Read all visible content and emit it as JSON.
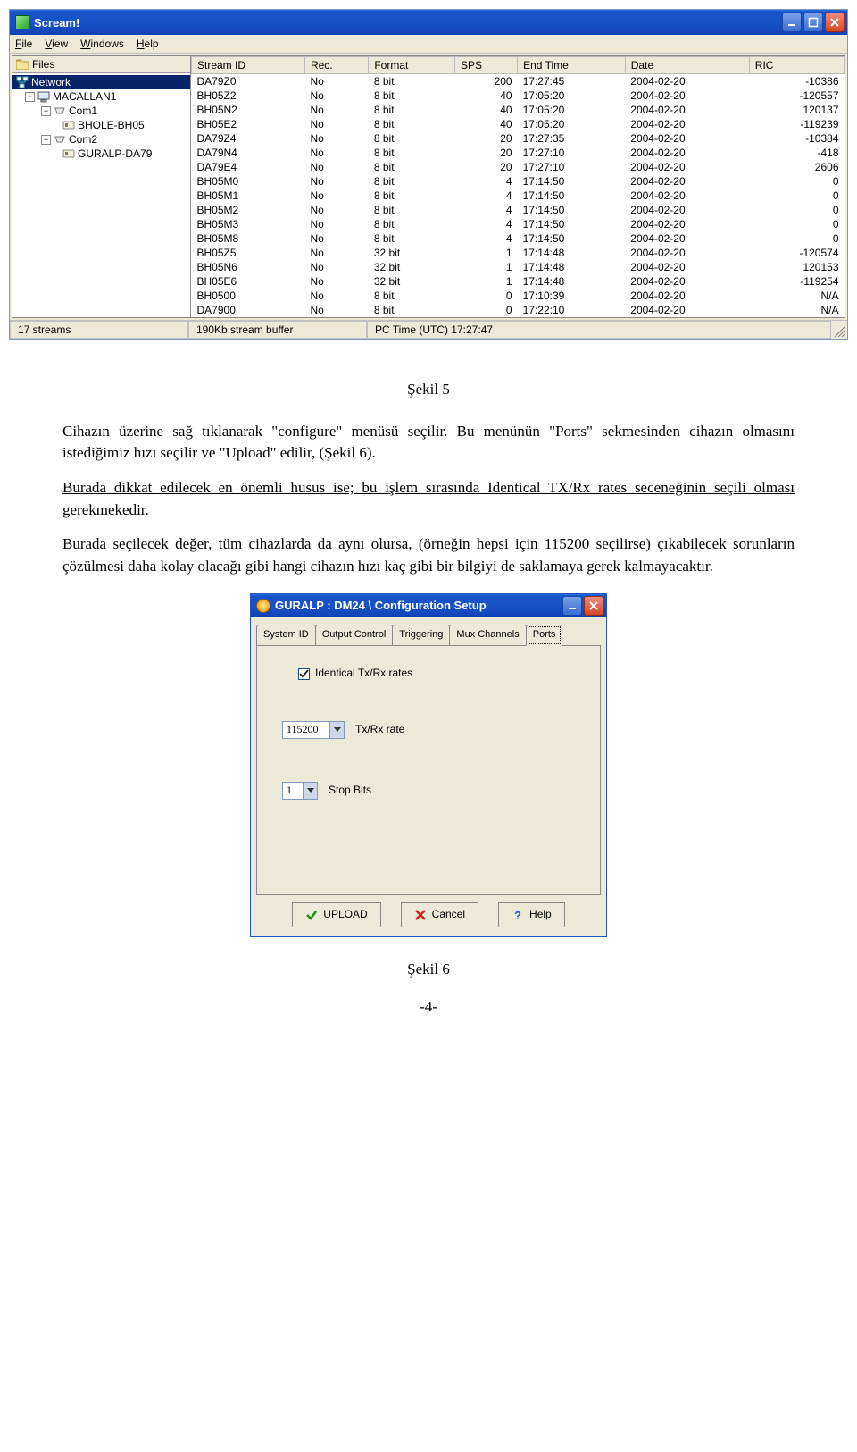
{
  "app_window": {
    "title": "Scream!",
    "menu": {
      "file": "File",
      "view": "View",
      "windows": "Windows",
      "help": "Help"
    },
    "tree": {
      "header": "Files",
      "root": "Network",
      "host": "MACALLAN1",
      "com1": "Com1",
      "com1_device": "BHOLE-BH05",
      "com2": "Com2",
      "com2_device": "GURALP-DA79"
    },
    "columns": {
      "c0": "Stream ID",
      "c1": "Rec.",
      "c2": "Format",
      "c3": "SPS",
      "c4": "End Time",
      "c5": "Date",
      "c6": "RIC"
    },
    "rows": [
      {
        "id": "DA79Z0",
        "rec": "No",
        "fmt": "8 bit",
        "sps": "200",
        "end": "17:27:45",
        "date": "2004-02-20",
        "ric": "-10386"
      },
      {
        "id": "BH05Z2",
        "rec": "No",
        "fmt": "8 bit",
        "sps": "40",
        "end": "17:05:20",
        "date": "2004-02-20",
        "ric": "-120557"
      },
      {
        "id": "BH05N2",
        "rec": "No",
        "fmt": "8 bit",
        "sps": "40",
        "end": "17:05:20",
        "date": "2004-02-20",
        "ric": "120137"
      },
      {
        "id": "BH05E2",
        "rec": "No",
        "fmt": "8 bit",
        "sps": "40",
        "end": "17:05:20",
        "date": "2004-02-20",
        "ric": "-119239"
      },
      {
        "id": "DA79Z4",
        "rec": "No",
        "fmt": "8 bit",
        "sps": "20",
        "end": "17:27:35",
        "date": "2004-02-20",
        "ric": "-10384"
      },
      {
        "id": "DA79N4",
        "rec": "No",
        "fmt": "8 bit",
        "sps": "20",
        "end": "17:27:10",
        "date": "2004-02-20",
        "ric": "-418"
      },
      {
        "id": "DA79E4",
        "rec": "No",
        "fmt": "8 bit",
        "sps": "20",
        "end": "17:27:10",
        "date": "2004-02-20",
        "ric": "2606"
      },
      {
        "id": "BH05M0",
        "rec": "No",
        "fmt": "8 bit",
        "sps": "4",
        "end": "17:14:50",
        "date": "2004-02-20",
        "ric": "0"
      },
      {
        "id": "BH05M1",
        "rec": "No",
        "fmt": "8 bit",
        "sps": "4",
        "end": "17:14:50",
        "date": "2004-02-20",
        "ric": "0"
      },
      {
        "id": "BH05M2",
        "rec": "No",
        "fmt": "8 bit",
        "sps": "4",
        "end": "17:14:50",
        "date": "2004-02-20",
        "ric": "0"
      },
      {
        "id": "BH05M3",
        "rec": "No",
        "fmt": "8 bit",
        "sps": "4",
        "end": "17:14:50",
        "date": "2004-02-20",
        "ric": "0"
      },
      {
        "id": "BH05M8",
        "rec": "No",
        "fmt": "8 bit",
        "sps": "4",
        "end": "17:14:50",
        "date": "2004-02-20",
        "ric": "0"
      },
      {
        "id": "BH05Z5",
        "rec": "No",
        "fmt": "32 bit",
        "sps": "1",
        "end": "17:14:48",
        "date": "2004-02-20",
        "ric": "-120574"
      },
      {
        "id": "BH05N6",
        "rec": "No",
        "fmt": "32 bit",
        "sps": "1",
        "end": "17:14:48",
        "date": "2004-02-20",
        "ric": "120153"
      },
      {
        "id": "BH05E6",
        "rec": "No",
        "fmt": "32 bit",
        "sps": "1",
        "end": "17:14:48",
        "date": "2004-02-20",
        "ric": "-119254"
      },
      {
        "id": "BH0500",
        "rec": "No",
        "fmt": "8 bit",
        "sps": "0",
        "end": "17:10:39",
        "date": "2004-02-20",
        "ric": "N/A"
      },
      {
        "id": "DA7900",
        "rec": "No",
        "fmt": "8 bit",
        "sps": "0",
        "end": "17:22:10",
        "date": "2004-02-20",
        "ric": "N/A"
      }
    ],
    "status": {
      "streams": "17 streams",
      "buffer": "190Kb stream buffer",
      "time": "PC Time (UTC)  17:27:47"
    }
  },
  "doc": {
    "caption1": "Şekil 5",
    "p1": "Cihazın üzerine sağ tıklanarak \"configure\" menüsü seçilir. Bu menünün \"Ports\" sekmesinden cihazın olmasını istediğimiz hızı seçilir ve \"Upload\" edilir, (Şekil 6).",
    "p2": "Burada dikkat edilecek en önemli husus ise; bu işlem sırasında Identical TX/Rx rates seceneğinin seçili olması gerekmekedir.",
    "p3": "Burada seçilecek değer, tüm cihazlarda da aynı olursa, (örneğin hepsi için 115200 seçilirse) çıkabilecek sorunların çözülmesi daha kolay olacağı gibi hangi cihazın hızı kaç gibi bir bilgiyi de saklamaya gerek kalmayacaktır.",
    "caption2": "Şekil 6",
    "page": "-4-"
  },
  "dialog": {
    "title": "GURALP : DM24    \\ Configuration Setup",
    "tabs": {
      "t0": "System ID",
      "t1": "Output Control",
      "t2": "Triggering",
      "t3": "Mux Channels",
      "t4": "Ports"
    },
    "identical_label": "Identical Tx/Rx rates",
    "txrx_value": "115200",
    "txrx_label": "Tx/Rx rate",
    "stop_value": "1",
    "stop_label": "Stop Bits",
    "buttons": {
      "upload": "UPLOAD",
      "cancel": "Cancel",
      "help": "Help"
    }
  }
}
